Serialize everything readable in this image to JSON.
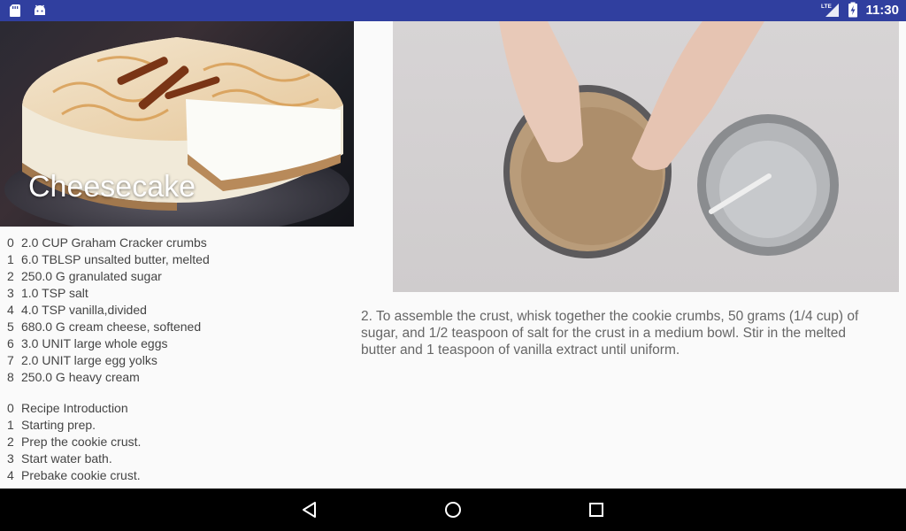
{
  "status_bar": {
    "time": "11:30",
    "left_icons": [
      "sd-card-icon",
      "android-icon"
    ],
    "right_icons": [
      "lte-signal-icon",
      "battery-charging-icon"
    ],
    "network": "LTE"
  },
  "hero": {
    "title": "Cheesecake"
  },
  "ingredients": [
    {
      "index": "0",
      "text": "2.0 CUP  Graham Cracker crumbs"
    },
    {
      "index": "1",
      "text": "6.0 TBLSP  unsalted butter, melted"
    },
    {
      "index": "2",
      "text": "250.0 G  granulated sugar"
    },
    {
      "index": "3",
      "text": "1.0 TSP  salt"
    },
    {
      "index": "4",
      "text": "4.0 TSP  vanilla,divided"
    },
    {
      "index": "5",
      "text": "680.0 G  cream cheese, softened"
    },
    {
      "index": "6",
      "text": "3.0 UNIT  large whole eggs"
    },
    {
      "index": "7",
      "text": "2.0 UNIT  large egg yolks"
    },
    {
      "index": "8",
      "text": "250.0 G  heavy cream"
    }
  ],
  "steps": [
    {
      "index": "0",
      "text": "Recipe Introduction"
    },
    {
      "index": "1",
      "text": "Starting prep."
    },
    {
      "index": "2",
      "text": "Prep the cookie crust."
    },
    {
      "index": "3",
      "text": "Start water bath."
    },
    {
      "index": "4",
      "text": "Prebake cookie crust."
    }
  ],
  "step_description": "2. To assemble the crust, whisk together the cookie crumbs, 50 grams (1/4 cup) of sugar, and 1/2 teaspoon of salt for the crust in a medium bowl. Stir in the melted butter and 1 teaspoon of vanilla extract until uniform.",
  "nav_bar": {
    "buttons": [
      "back-icon",
      "home-icon",
      "recents-icon"
    ]
  },
  "colors": {
    "status_bar": "#303f9f",
    "background": "#fafafa",
    "text": "#444444",
    "description_text": "#666666",
    "nav_bar": "#000000"
  }
}
